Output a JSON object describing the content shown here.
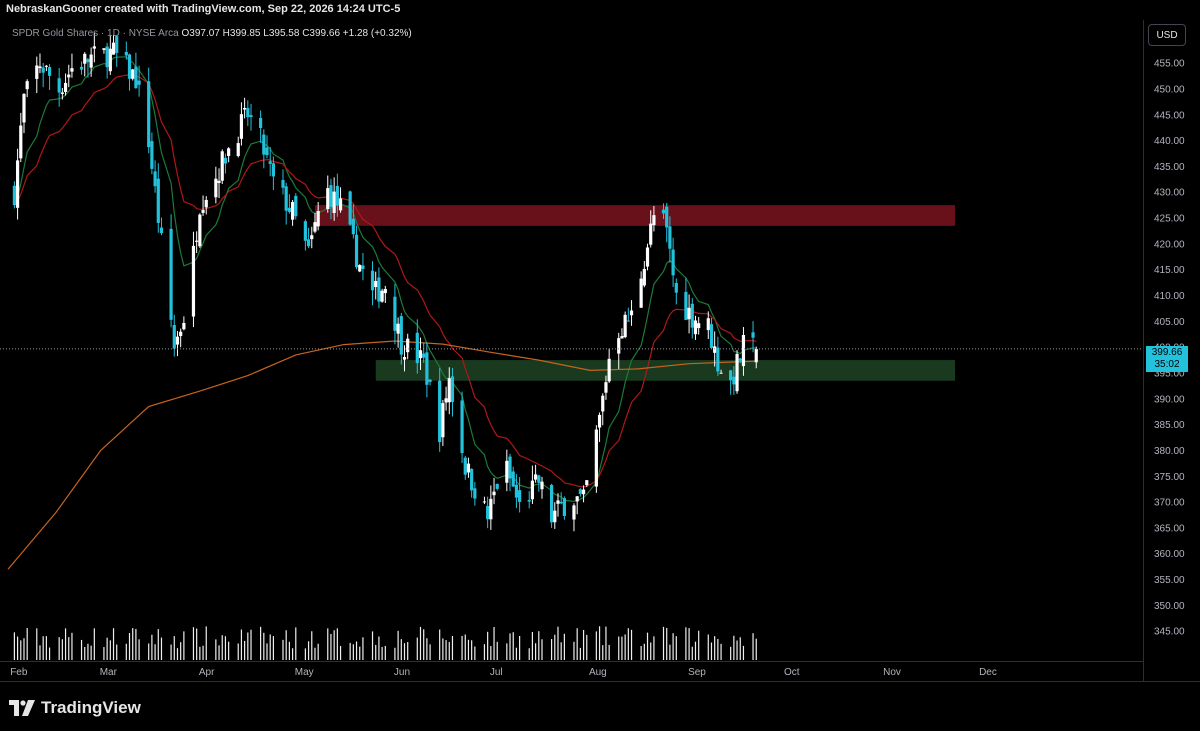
{
  "header": {
    "credit": "NebraskanGooner created with TradingView.com, Sep 22, 2026 14:24 UTC-5",
    "symbol": "SPDR Gold Shares · 1D · NYSE Arca",
    "open": "O397.07",
    "high": "H399.85",
    "low": "L395.58",
    "close": "C399.66",
    "change": "+1.28 (+0.32%)"
  },
  "currency_label": "USD",
  "brand": {
    "name": "TradingView"
  },
  "last_price": {
    "price": "399.66",
    "countdown": "35:02"
  },
  "colors": {
    "up_candle": "#ffffff",
    "down_candle": "#22c1dc",
    "ema_fast": "#1b7a3a",
    "ema_slow": "#b01818",
    "sma_long": "#c7641e",
    "resistance_zone": "#7a1420",
    "support_zone": "#1e4424",
    "volume": "#eeeeee"
  },
  "chart_data": {
    "type": "candlestick",
    "y_range": [
      340,
      462
    ],
    "y_ticks": [
      "345.00",
      "350.00",
      "355.00",
      "360.00",
      "365.00",
      "370.00",
      "375.00",
      "380.00",
      "385.00",
      "390.00",
      "395.00",
      "400.00",
      "405.00",
      "410.00",
      "415.00",
      "420.00",
      "425.00",
      "430.00",
      "435.00",
      "440.00",
      "445.00",
      "450.00",
      "455.00"
    ],
    "x_labels": [
      {
        "label": "Feb",
        "date": "2026-02-01"
      },
      {
        "label": "Mar",
        "date": "2026-03-01"
      },
      {
        "label": "Apr",
        "date": "2026-04-01"
      },
      {
        "label": "May",
        "date": "2026-05-01"
      },
      {
        "label": "Jun",
        "date": "2026-06-01"
      },
      {
        "label": "Jul",
        "date": "2026-07-01"
      },
      {
        "label": "Aug",
        "date": "2026-08-01"
      },
      {
        "label": "Sep",
        "date": "2026-09-01"
      },
      {
        "label": "Oct",
        "date": "2026-10-01"
      },
      {
        "label": "Nov",
        "date": "2026-11-01"
      },
      {
        "label": "Dec",
        "date": "2026-12-01"
      }
    ],
    "x_range": [
      "2026-01-31",
      "2026-12-31"
    ],
    "zones": [
      {
        "kind": "resistance",
        "low": 423.5,
        "high": 427.5,
        "from": "2026-05-07",
        "to": "2026-12-31"
      },
      {
        "kind": "support",
        "low": 393.5,
        "high": 397.5,
        "from": "2026-05-26",
        "to": "2026-12-31"
      }
    ],
    "ohlc_anchors": [
      [
        "2026-02-02",
        430
      ],
      [
        "2026-02-05",
        448
      ],
      [
        "2026-02-10",
        455
      ],
      [
        "2026-02-16",
        450
      ],
      [
        "2026-02-20",
        454
      ],
      [
        "2026-02-26",
        456
      ],
      [
        "2026-03-05",
        457
      ],
      [
        "2026-03-12",
        452
      ],
      [
        "2026-03-16",
        440
      ],
      [
        "2026-03-20",
        420
      ],
      [
        "2026-03-24",
        400
      ],
      [
        "2026-03-28",
        408
      ],
      [
        "2026-04-01",
        428
      ],
      [
        "2026-04-06",
        433
      ],
      [
        "2026-04-11",
        440
      ],
      [
        "2026-04-16",
        445
      ],
      [
        "2026-04-20",
        440
      ],
      [
        "2026-04-24",
        432
      ],
      [
        "2026-04-30",
        426
      ],
      [
        "2026-05-05",
        418
      ],
      [
        "2026-05-10",
        431
      ],
      [
        "2026-05-15",
        427
      ],
      [
        "2026-05-21",
        416
      ],
      [
        "2026-05-25",
        410
      ],
      [
        "2026-05-29",
        412
      ],
      [
        "2026-06-03",
        401
      ],
      [
        "2026-06-10",
        397
      ],
      [
        "2026-06-15",
        384
      ],
      [
        "2026-06-18",
        394
      ],
      [
        "2026-06-23",
        377
      ],
      [
        "2026-06-30",
        367
      ],
      [
        "2026-07-05",
        378
      ],
      [
        "2026-07-10",
        369
      ],
      [
        "2026-07-16",
        374
      ],
      [
        "2026-07-20",
        367
      ],
      [
        "2026-07-26",
        371
      ],
      [
        "2026-07-30",
        370
      ],
      [
        "2026-08-04",
        386
      ],
      [
        "2026-08-08",
        402
      ],
      [
        "2026-08-14",
        406
      ],
      [
        "2026-08-19",
        420
      ],
      [
        "2026-08-22",
        428
      ],
      [
        "2026-08-25",
        422
      ],
      [
        "2026-08-28",
        410
      ],
      [
        "2026-09-02",
        406
      ],
      [
        "2026-09-07",
        404
      ],
      [
        "2026-09-10",
        397
      ],
      [
        "2026-09-14",
        393
      ],
      [
        "2026-09-18",
        400
      ],
      [
        "2026-09-22",
        399.66
      ]
    ],
    "series": [
      {
        "name": "",
        "kind": "ema_fast"
      },
      {
        "name": "",
        "kind": "ema_slow"
      },
      {
        "name": "",
        "kind": "sma_long",
        "points": [
          [
            "2026-01-31",
            357
          ],
          [
            "2026-02-15",
            368
          ],
          [
            "2026-03-01",
            380
          ],
          [
            "2026-03-16",
            388.5
          ],
          [
            "2026-04-01",
            391.5
          ],
          [
            "2026-04-16",
            394.5
          ],
          [
            "2026-05-01",
            398.5
          ],
          [
            "2026-05-16",
            400.5
          ],
          [
            "2026-06-01",
            401.2
          ],
          [
            "2026-06-16",
            400.6
          ],
          [
            "2026-07-01",
            399
          ],
          [
            "2026-07-16",
            397.5
          ],
          [
            "2026-08-01",
            395.5
          ],
          [
            "2026-08-16",
            395.8
          ],
          [
            "2026-09-01",
            396.8
          ],
          [
            "2026-09-22",
            397.3
          ]
        ]
      }
    ],
    "volume_panel": true,
    "grid": false
  }
}
